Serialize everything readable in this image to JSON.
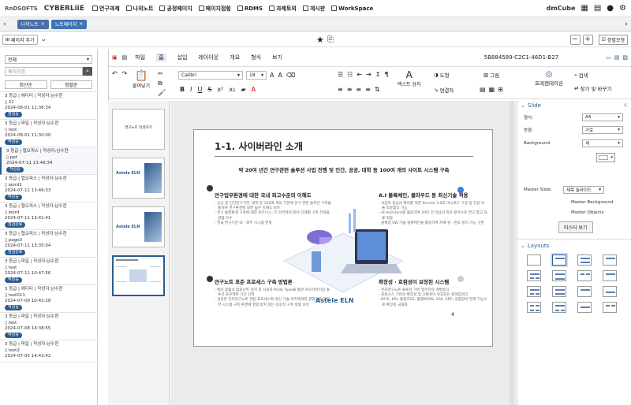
{
  "topnav": {
    "brand1": "RnDSOFTS",
    "brand2": "CYBERLiiE",
    "items": [
      "연구과제",
      "나의노트",
      "공정페이지",
      "페이지접힘",
      "RDMS",
      "과제토의",
      "게시판",
      "WorkSpace"
    ],
    "right_brand": "dmCube"
  },
  "tabs": [
    {
      "label": "나의노트"
    },
    {
      "label": "노트페이지"
    }
  ],
  "toolbar2": {
    "add_page": "페이지 추가",
    "minus": "−",
    "plus": "+",
    "wide_mode": "정렬모형"
  },
  "left": {
    "filter": "전체",
    "search_placeholder": "페이지명",
    "sort_recent": "최신순",
    "sort_title": "정렬순",
    "items": [
      {
        "meta": "3 등급 | 에디터 | 작성자:남수현",
        "title": "22",
        "date": "2024-08-01 11:36:34",
        "badge": "점검중"
      },
      {
        "meta": "3 등급 | 파일 | 작성자:남수현",
        "title": "test",
        "date": "2024-08-01 11:30:00",
        "badge": "작성중"
      },
      {
        "meta": "3 등급 | 협오피스 | 작성자:남수현",
        "title": "ppt",
        "date": "2024-07-11 13:49:34",
        "badge": "작성중"
      },
      {
        "meta": "3 등급 | 협오피스 | 작성자:남수현",
        "title": "word1",
        "date": "2024-07-11 13:46:33",
        "badge": "작성중"
      },
      {
        "meta": "3 등급 | 협오피스 | 작성자:남수현",
        "title": "word",
        "date": "2024-07-11 13:41:41",
        "badge": "점검완료"
      },
      {
        "meta": "3 등급 | 협오피스 | 작성자:남수현",
        "title": "page3",
        "date": "2024-07-11 13:35:04",
        "badge": "점검완료"
      },
      {
        "meta": "3 등급 | 파일 | 작성자:남수현",
        "title": "test",
        "date": "2024-07-11 10:47:56",
        "badge": "작성중"
      },
      {
        "meta": "3 등급 | 에디터 | 작성자:남수현",
        "title": "test011",
        "date": "2024-07-09 10:42:28",
        "badge": "작성중"
      },
      {
        "meta": "3 등급 | 파일 | 작성자:남수현",
        "title": "test",
        "date": "2024-07-08 14:38:55",
        "badge": "작성중"
      },
      {
        "meta": "3 등급 | 파일 | 작성자:남수현",
        "title": "test2",
        "date": "2024-07-05 14:43:42",
        "badge": ""
      }
    ]
  },
  "editor": {
    "menu": [
      "파일",
      "홈",
      "삽입",
      "레이아웃",
      "개요",
      "형식",
      "보기"
    ],
    "doc_id": "5B884589-C2C1-46D1-B27",
    "font": "Calibri",
    "size": "18",
    "paste": "붙여넣기",
    "textbox": "텍스트 상자",
    "shape": "도형",
    "image": "그림",
    "connector": "연결자",
    "presentation": "프레젠테이션",
    "find": "검색",
    "replace": "찾기 및 바꾸기"
  },
  "thumbs": {
    "t1": "연구노트 작성하기",
    "t2": "Astele ELN"
  },
  "slide": {
    "title": "1-1. 사이버라인 소개",
    "subtitle": "약 20여 년간 연구관련 솔루션 사업 진행 및 인간, 공공, 대학 등 100여 개의 사이트 시스템 구축",
    "h1": "연구업무환경에 대한 국내 최고수준의 이해도",
    "b1": [
      "공공 및 민간연구기관, 대학 등 100여 개의 기관에 연구 관련 솔루션 구축을 통하여 연구환경에 대한 높은 이해도 보유",
      "연구 통합환경 구축에 대한 비즈니스, IT 아키텍처 분야 단계별 구축 전략을 경험 다수",
      "한국 연구기관 내 · 외부 시스템 연계"
    ],
    "h2": "A.I 블록체인, 클라우드 등 최신기술 적용",
    "b2": [
      "사용자 중심의 편의를 위한 Servlet 3.0과 머시포드 구성 및 전용 모듈 적용함상 가능",
      "AI Assistant를 활용하여 30만 건 이상의 피로 분석으로 연구 참고 자료 적용",
      "블록첩 SW 기술 블록체인을 활용하여 저해 위 · 변조 방지 기능 구현"
    ],
    "h3": "연구노트 표준 프로세스 구축 방법론",
    "b3": [
      "메타 맞춤식 컴포넌트 설치 후 사용자 Proto Type을 통한 커스터마이징 솔루션 프로젝트 기간 단축",
      "검증된 전자연구노트 관련 프로세스화 최신 기술 아키텍처와 결합으로 다양한 시스템 구축 환경에 영향 받지 않는 응용적 구축 방법 보유"
    ],
    "h4": "확장성 · 호환성이 보장된 시스템",
    "b4": [
      "전자연구노트 솔루션 기반 업무단의 개발방식",
      "표준소스 기반의 확장성 및 호환성이 보장되는 프레임워크",
      "NTIS, KRI, 통합리SS, 통합RCMS, SAP, ERP, 실험장비 연계 기능으로 확장성 극대화"
    ],
    "logo": "Astele ELN",
    "page_number": "4"
  },
  "right": {
    "section": "Slide",
    "size_label": "형식:",
    "size_value": "A4",
    "orient_label": "방향:",
    "orient_value": "가로",
    "bg_label": "Background:",
    "bg_value": "색",
    "master_label": "Master Slide:",
    "master_value": "제목 슬라이드",
    "master_bg": "Master Background",
    "master_obj": "Master Objects",
    "master_view": "마스터 보기",
    "layouts": "Layouts"
  },
  "colors": {
    "accent": "#2d5c8f",
    "tab1": "#4a6fa5",
    "tab2": "#3f74b3"
  }
}
